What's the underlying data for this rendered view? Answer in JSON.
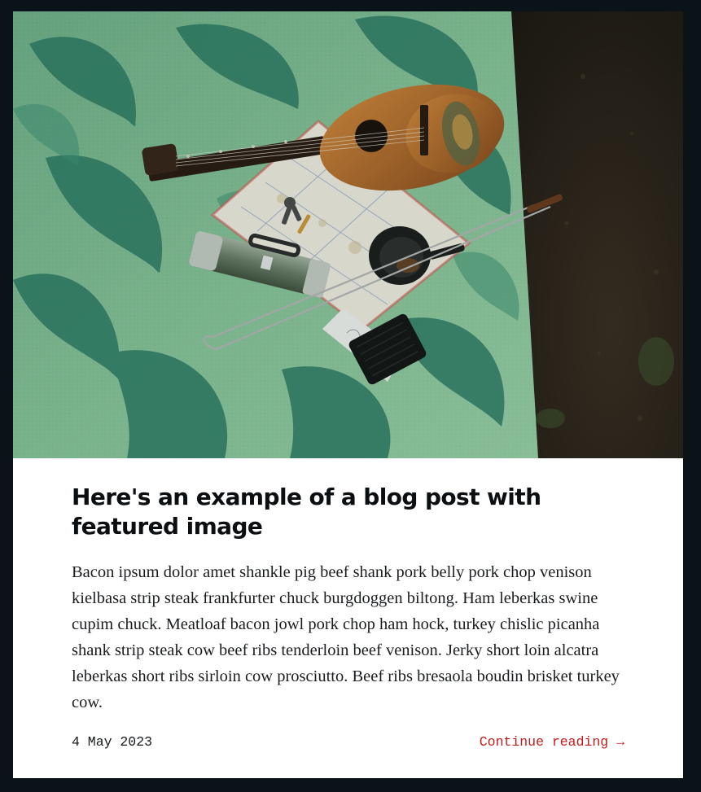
{
  "post": {
    "title": "Here's an example of a blog post with featured image",
    "excerpt": "Bacon ipsum dolor amet shankle pig beef shank pork belly pork chop venison kielbasa strip steak frankfurter chuck burgdoggen biltong. Ham leberkas swine cupim chuck. Meatloaf bacon jowl pork chop ham hock, turkey chislic picanha shank strip steak cow beef ribs tenderloin beef venison. Jerky short loin alcatra leberkas short ribs sirloin cow prosciutto. Beef ribs bresaola boudin brisket turkey cow.",
    "date": "4 May 2023",
    "continue_label": "Continue reading →"
  },
  "colors": {
    "page_background": "#0a1317",
    "card_background": "#ffffff",
    "link_accent": "#c01c1c"
  }
}
